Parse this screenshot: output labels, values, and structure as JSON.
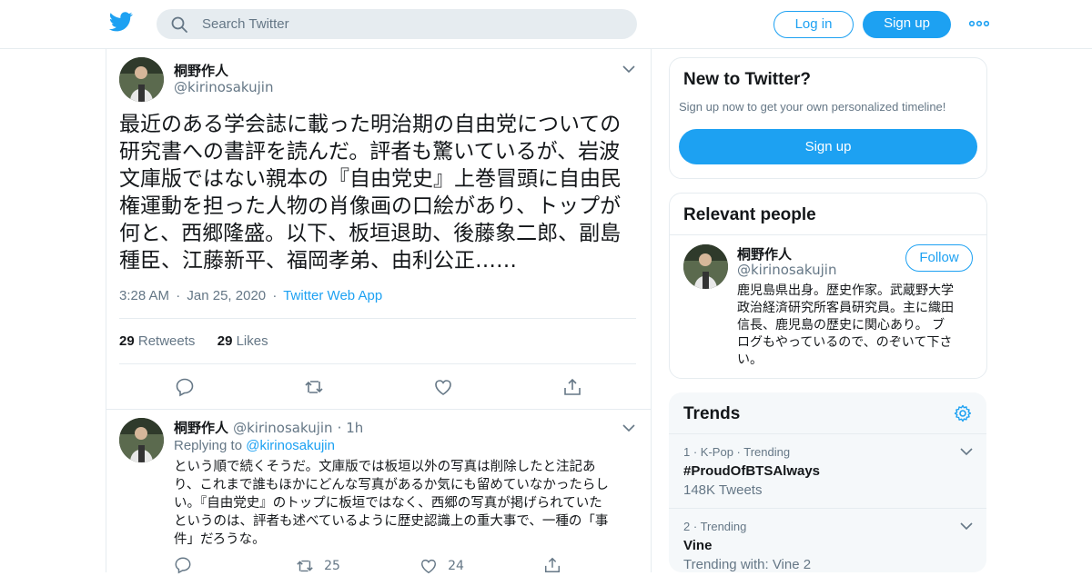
{
  "header": {
    "search_placeholder": "Search Twitter",
    "login_label": "Log in",
    "signup_label": "Sign up",
    "logo_icon": "twitter-bird-icon",
    "more_icon": "more-dots-icon"
  },
  "colors": {
    "accent": "#1da1f2",
    "text": "#14171a",
    "muted": "#657786",
    "border": "#e6ecf0"
  },
  "main_tweet": {
    "author_name": "桐野作人",
    "author_handle": "@kirinosakujin",
    "text_lines": [
      "最近のある学会誌に載った明治期の自由党についての",
      "研究書への書評を読んだ。評者も驚いているが、岩波",
      "文庫版ではない親本の『自由党史』上巻冒頭に自由民",
      "権運動を担った人物の肖像画の口絵があり、トップが",
      "何と、西郷隆盛。以下、板垣退助、後藤象二郎、副島",
      "種臣、江藤新平、福岡孝弟、由利公正……"
    ],
    "time": "3:28 AM",
    "date": "Jan 25, 2020",
    "source": "Twitter Web App",
    "retweets_count": "29",
    "retweets_label": "Retweets",
    "likes_count": "29",
    "likes_label": "Likes"
  },
  "reply_tweet": {
    "author_name": "桐野作人",
    "author_handle": "@kirinosakujin",
    "age": "1h",
    "replying_prefix": "Replying to",
    "replying_handle": "@kirinosakujin",
    "text_lines": [
      "という順で続くそうだ。文庫版では板垣以外の写真は削除したと注記あ",
      "り、これまで誰もほかにどんな写真があるか気にも留めていなかったらし",
      "い。『自由党史』のトップに板垣ではなく、西郷の写真が掲げられていた",
      "というのは、評者も述べているように歴史認識上の重大事で、一種の「事",
      "件」だろうな。"
    ],
    "retweet_count": "25",
    "like_count": "24"
  },
  "new_to_twitter": {
    "title": "New to Twitter?",
    "subtitle": "Sign up now to get your own personalized timeline!",
    "signup_label": "Sign up"
  },
  "relevant_people": {
    "title": "Relevant people",
    "name": "桐野作人",
    "handle": "@kirinosakujin",
    "follow_label": "Follow",
    "bio_lines": [
      "鹿児島県出身。歴史作家。武蔵野大学",
      "政治経済研究所客員研究員。主に織田",
      "信長、鹿児島の歴史に関心あり。 ブ",
      "ログもやっているので、のぞいて下さ",
      "い。"
    ]
  },
  "trends": {
    "title": "Trends",
    "items": [
      {
        "rank": "1",
        "category": "K-Pop",
        "status": "Trending",
        "name": "#ProudOfBTSAlways",
        "sub": "148K Tweets"
      },
      {
        "rank": "2",
        "category": "",
        "status": "Trending",
        "name": "Vine",
        "sub": "Trending with: Vine 2"
      }
    ]
  }
}
